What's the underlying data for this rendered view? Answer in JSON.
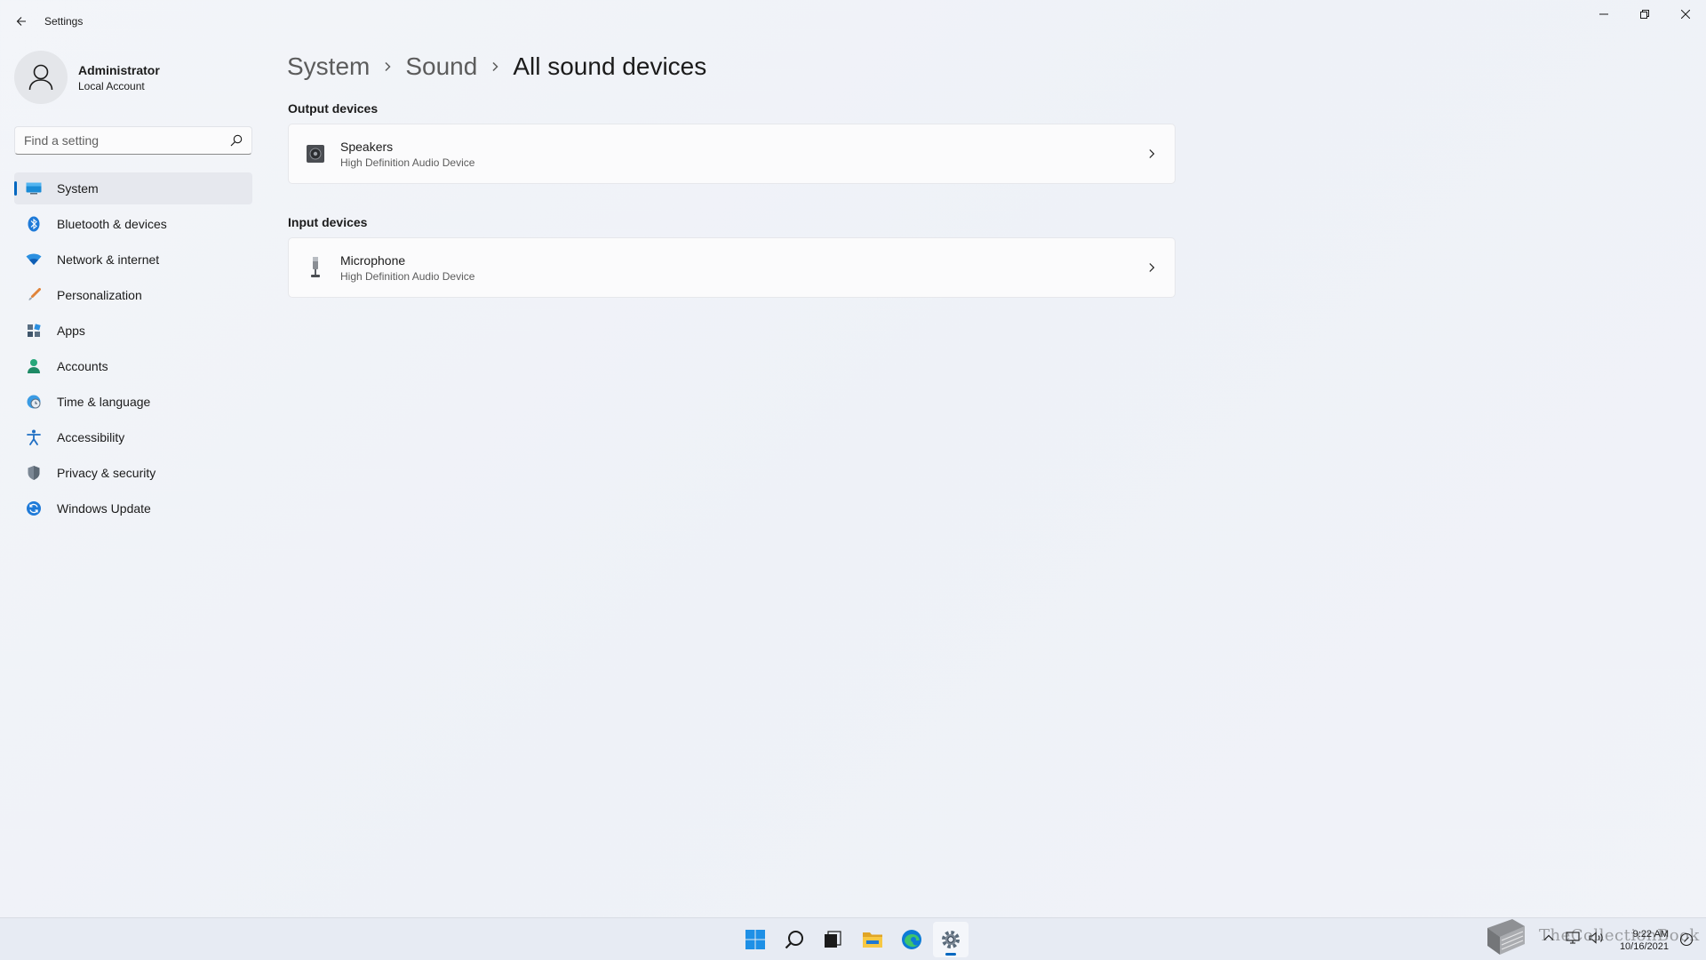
{
  "window": {
    "title": "Settings"
  },
  "profile": {
    "name": "Administrator",
    "account_type": "Local Account"
  },
  "search": {
    "placeholder": "Find a setting"
  },
  "sidebar": {
    "items": [
      {
        "label": "System",
        "icon": "system-icon",
        "active": true
      },
      {
        "label": "Bluetooth & devices",
        "icon": "bluetooth-icon"
      },
      {
        "label": "Network & internet",
        "icon": "wifi-icon"
      },
      {
        "label": "Personalization",
        "icon": "brush-icon"
      },
      {
        "label": "Apps",
        "icon": "apps-icon"
      },
      {
        "label": "Accounts",
        "icon": "person-icon"
      },
      {
        "label": "Time & language",
        "icon": "globe-clock-icon"
      },
      {
        "label": "Accessibility",
        "icon": "accessibility-icon"
      },
      {
        "label": "Privacy & security",
        "icon": "shield-icon"
      },
      {
        "label": "Windows Update",
        "icon": "update-icon"
      }
    ]
  },
  "breadcrumb": {
    "items": [
      "System",
      "Sound",
      "All sound devices"
    ]
  },
  "sections": {
    "output": {
      "title": "Output devices",
      "devices": [
        {
          "name": "Speakers",
          "description": "High Definition Audio Device",
          "icon": "speaker-icon"
        }
      ]
    },
    "input": {
      "title": "Input devices",
      "devices": [
        {
          "name": "Microphone",
          "description": "High Definition Audio Device",
          "icon": "microphone-icon"
        }
      ]
    }
  },
  "taskbar": {
    "apps": [
      "start-icon",
      "search-icon",
      "task-view-icon",
      "file-explorer-icon",
      "edge-icon",
      "settings-icon"
    ],
    "active_app": "settings-icon",
    "watermark_text": "TheCollectionBook",
    "clock": {
      "time": "9:22 AM",
      "date": "10/16/2021"
    }
  },
  "colors": {
    "accent": "#0067c0",
    "background": "#f3f5f9",
    "card": "#fbfbfc"
  }
}
